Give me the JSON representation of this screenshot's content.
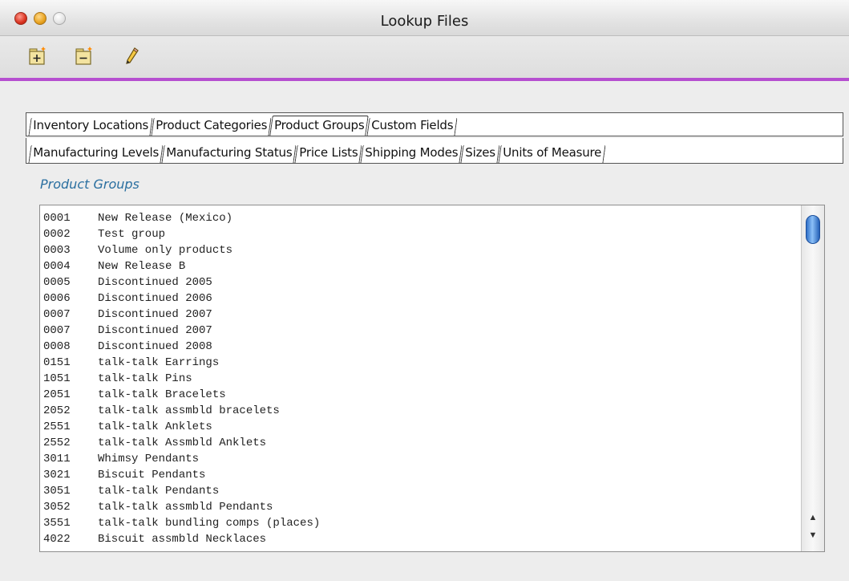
{
  "window": {
    "title": "Lookup Files"
  },
  "toolbar": {
    "icons": [
      "add-record-icon",
      "remove-record-icon",
      "edit-pencil-icon"
    ]
  },
  "tabs_row1": [
    {
      "label": "Inventory Locations"
    },
    {
      "label": "Product Categories"
    },
    {
      "label": "Product Groups"
    },
    {
      "label": "Custom Fields"
    }
  ],
  "tabs_row2": [
    {
      "label": "Manufacturing Levels"
    },
    {
      "label": "Manufacturing Status"
    },
    {
      "label": "Price Lists"
    },
    {
      "label": "Shipping Modes"
    },
    {
      "label": "Sizes"
    },
    {
      "label": "Units of Measure"
    }
  ],
  "section": {
    "title": "Product Groups"
  },
  "list": {
    "rows": [
      {
        "code": "0001",
        "name": "New Release (Mexico)"
      },
      {
        "code": "0002",
        "name": "Test group"
      },
      {
        "code": "0003",
        "name": "Volume only products"
      },
      {
        "code": "0004",
        "name": "New Release B"
      },
      {
        "code": "0005",
        "name": "Discontinued 2005"
      },
      {
        "code": "0006",
        "name": "Discontinued 2006"
      },
      {
        "code": "0007",
        "name": "Discontinued 2007"
      },
      {
        "code": "0007",
        "name": "Discontinued 2007"
      },
      {
        "code": "0008",
        "name": "Discontinued 2008"
      },
      {
        "code": "0151",
        "name": "talk-talk Earrings"
      },
      {
        "code": "1051",
        "name": "talk-talk Pins"
      },
      {
        "code": "2051",
        "name": "talk-talk Bracelets"
      },
      {
        "code": "2052",
        "name": "talk-talk assmbld bracelets"
      },
      {
        "code": "2551",
        "name": "talk-talk Anklets"
      },
      {
        "code": "2552",
        "name": "talk-talk Assmbld Anklets"
      },
      {
        "code": "3011",
        "name": "Whimsy Pendants"
      },
      {
        "code": "3021",
        "name": "Biscuit Pendants"
      },
      {
        "code": "3051",
        "name": "talk-talk Pendants"
      },
      {
        "code": "3052",
        "name": "talk-talk assmbld Pendants"
      },
      {
        "code": "3551",
        "name": "talk-talk bundling comps (places)"
      },
      {
        "code": "4022",
        "name": "Biscuit assmbld Necklaces"
      }
    ]
  },
  "colors": {
    "accent_line": "#b64fd0",
    "section_title": "#2a6fa0",
    "scroll_thumb": "#2f6fc8"
  }
}
